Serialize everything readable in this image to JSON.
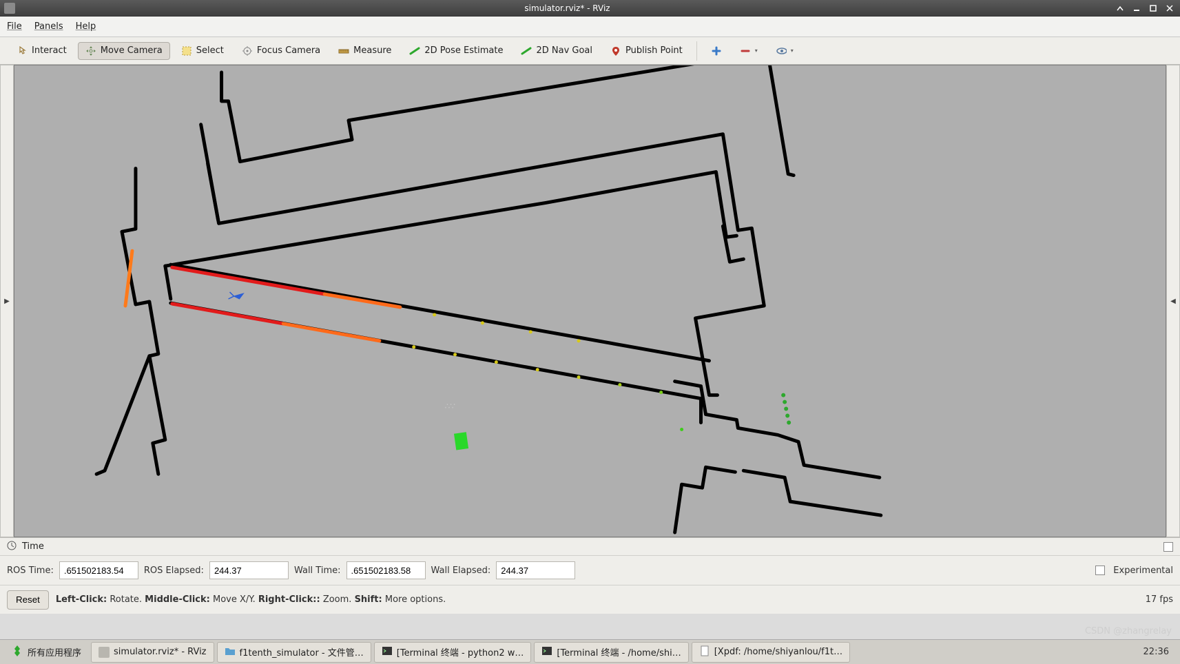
{
  "window": {
    "title": "simulator.rviz* - RViz"
  },
  "menu": {
    "file": "File",
    "panels": "Panels",
    "help": "Help"
  },
  "toolbar": {
    "interact": "Interact",
    "move_camera": "Move Camera",
    "select": "Select",
    "focus_camera": "Focus Camera",
    "measure": "Measure",
    "pose_estimate": "2D Pose Estimate",
    "nav_goal": "2D Nav Goal",
    "publish_point": "Publish Point"
  },
  "time": {
    "header": "Time",
    "ros_time_label": "ROS Time:",
    "ros_time_value": ".651502183.54",
    "ros_elapsed_label": "ROS Elapsed:",
    "ros_elapsed_value": "244.37",
    "wall_time_label": "Wall Time:",
    "wall_time_value": ".651502183.58",
    "wall_elapsed_label": "Wall Elapsed:",
    "wall_elapsed_value": "244.37",
    "experimental_label": "Experimental"
  },
  "bottom": {
    "reset": "Reset",
    "hint_left_bold": "Left-Click:",
    "hint_left": " Rotate. ",
    "hint_mid_bold": "Middle-Click:",
    "hint_mid": " Move X/Y. ",
    "hint_right_bold": "Right-Click::",
    "hint_right": " Zoom. ",
    "hint_shift_bold": "Shift:",
    "hint_shift": " More options.",
    "fps": "17 fps"
  },
  "taskbar": {
    "apps": "所有应用程序",
    "t1": "simulator.rviz* - RViz",
    "t2": "f1tenth_simulator - 文件管…",
    "t3": "[Terminal 终端 - python2 w…",
    "t4": "[Terminal 终端 - /home/shi…",
    "t5": "[Xpdf: /home/shiyanlou/f1t…",
    "clock": "22:36"
  },
  "watermark": "CSDN @zhangrelay"
}
